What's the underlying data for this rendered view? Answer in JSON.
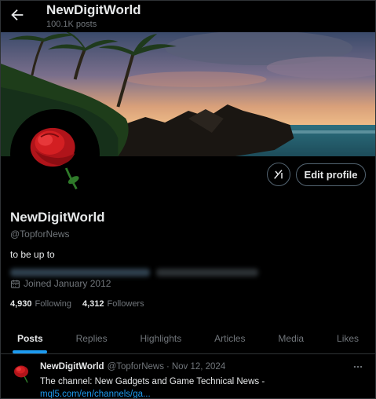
{
  "header": {
    "title": "NewDigitWorld",
    "posts_count": "100.1K posts"
  },
  "profile": {
    "name": "NewDigitWorld",
    "handle": "@TopforNews",
    "bio": "to be up to",
    "joined": "Joined January 2012",
    "following_count": "4,930",
    "following_label": "Following",
    "followers_count": "4,312",
    "followers_label": "Followers"
  },
  "buttons": {
    "edit_profile": "Edit profile",
    "grok_icon": "grok-icon"
  },
  "tabs": [
    {
      "label": "Posts",
      "active": true
    },
    {
      "label": "Replies",
      "active": false
    },
    {
      "label": "Highlights",
      "active": false
    },
    {
      "label": "Articles",
      "active": false
    },
    {
      "label": "Media",
      "active": false
    },
    {
      "label": "Likes",
      "active": false
    }
  ],
  "post": {
    "name": "NewDigitWorld",
    "handle": "@TopforNews",
    "sep": "·",
    "date": "Nov 12, 2024",
    "text": "The channel: New Gadgets and Game Technical News -",
    "link": "mql5.com/en/channels/ga..."
  },
  "colors": {
    "background": "#000000",
    "text_primary": "#e7e9ea",
    "text_secondary": "#71767b",
    "accent": "#1d9bf0",
    "border": "#2f3336"
  },
  "icons": [
    "back-arrow-icon",
    "grok-icon",
    "calendar-icon",
    "more-icon",
    "rose-avatar"
  ]
}
